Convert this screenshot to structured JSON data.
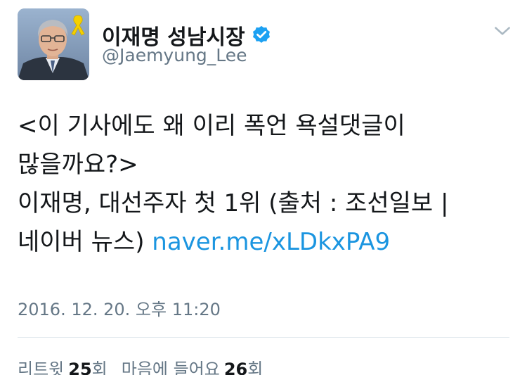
{
  "header": {
    "display_name": "이재명 성남시장",
    "handle": "@Jaemyung_Lee",
    "verified_icon": "verified-badge-icon",
    "menu_icon": "chevron-down-icon"
  },
  "tweet": {
    "text": "<이 기사에도 왜 이리 폭언 욕설댓글이 많을까요?>\n이재명, 대선주자 첫 1위 (출처 : 조선일보 | 네이버 뉴스) ",
    "link": "naver.me/xLDkxPA9",
    "timestamp": "2016. 12. 20. 오후 11:20"
  },
  "stats": {
    "retweets_label": "리트윗",
    "retweets_count": "25",
    "retweets_unit": "회",
    "likes_label": "마음에 들어요",
    "likes_count": "26",
    "likes_unit": "회"
  },
  "colors": {
    "link": "#1b95e0",
    "verified": "#1da1f2",
    "secondary_text": "#657786"
  }
}
